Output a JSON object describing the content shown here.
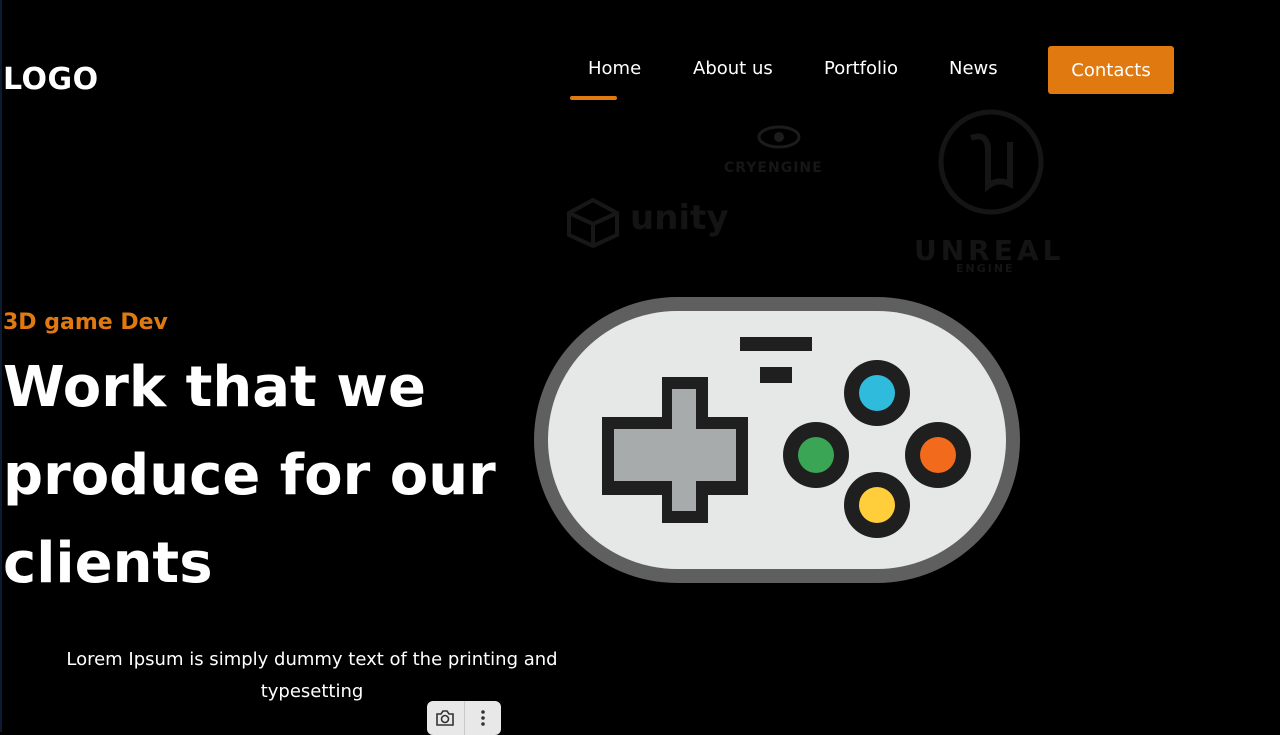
{
  "logo": {
    "text": "LOGO"
  },
  "nav": {
    "items": [
      {
        "label": "Home",
        "active": true
      },
      {
        "label": "About us",
        "active": false
      },
      {
        "label": "Portfolio",
        "active": false
      },
      {
        "label": "News",
        "active": false
      }
    ],
    "contacts_label": "Contacts",
    "accent_color": "#e07a10"
  },
  "engines": {
    "cryengine": "CRYENGINE",
    "unity": "unity",
    "unreal": "UNREAL",
    "unreal_sub": "ENGINE"
  },
  "hero": {
    "subtitle": "3D game Dev",
    "title_line1": "Work that we",
    "title_line2": "produce for our",
    "title_line3": "clients",
    "description": "Lorem Ipsum is simply dummy text of the printing and typesetting"
  },
  "gamepad": {
    "icon": "gamepad-icon",
    "button_colors": {
      "top": "#2fbcdc",
      "left": "#3aa655",
      "right": "#f26a1b",
      "bottom": "#ffce3a"
    }
  },
  "toolbar": {
    "icons": [
      "camera-icon",
      "more-vertical-icon"
    ]
  }
}
